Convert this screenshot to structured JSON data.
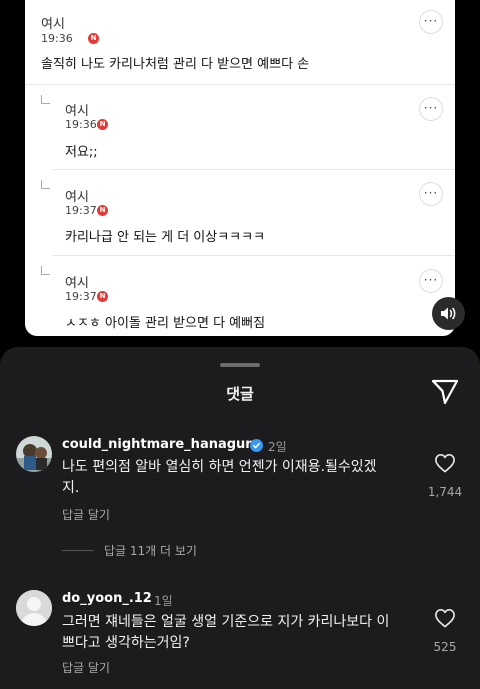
{
  "post": {
    "comments": [
      {
        "nick": "여시",
        "time": "19:36",
        "badge": "N",
        "body": "솔직히 나도 카리나처럼 관리 다 받으면 예쁘다 손",
        "reply": false
      },
      {
        "nick": "여시",
        "time": "19:36",
        "badge": "N",
        "body": "저요;;",
        "reply": true
      },
      {
        "nick": "여시",
        "time": "19:37",
        "badge": "N",
        "body": "카리나급 안 되는 게 더 이상ㅋㅋㅋㅋ",
        "reply": true
      },
      {
        "nick": "여시",
        "time": "19:37",
        "badge": "N",
        "body": "ㅅㅈㅎ 아이돌 관리 받으면 다 예뻐짐",
        "reply": true
      }
    ],
    "more_label": "···"
  },
  "sheet": {
    "title": "댓글",
    "comments": [
      {
        "username": "could_nightmare_hanaguru",
        "verified": true,
        "age": "2일",
        "text_line1": "나도 편의점 알바 열심히 하면 언젠가 이재용.될수있겠",
        "text_line2": "지.",
        "reply_label": "답글 달기",
        "view_more": "답글 11개 더 보기",
        "likes": "1,744"
      },
      {
        "username": "do_yoon_.12",
        "verified": false,
        "age": "1일",
        "text_line1": "그러면 쟤네들은 얼굴 생얼 기준으로 지가 카리나보다 이",
        "text_line2": "쁘다고 생각하는거임?",
        "reply_label": "답글 달기",
        "likes": "525"
      }
    ]
  },
  "colors": {
    "badge": "#e53935",
    "verified": "#3897f0",
    "sheet_bg": "#1c1c1e"
  }
}
